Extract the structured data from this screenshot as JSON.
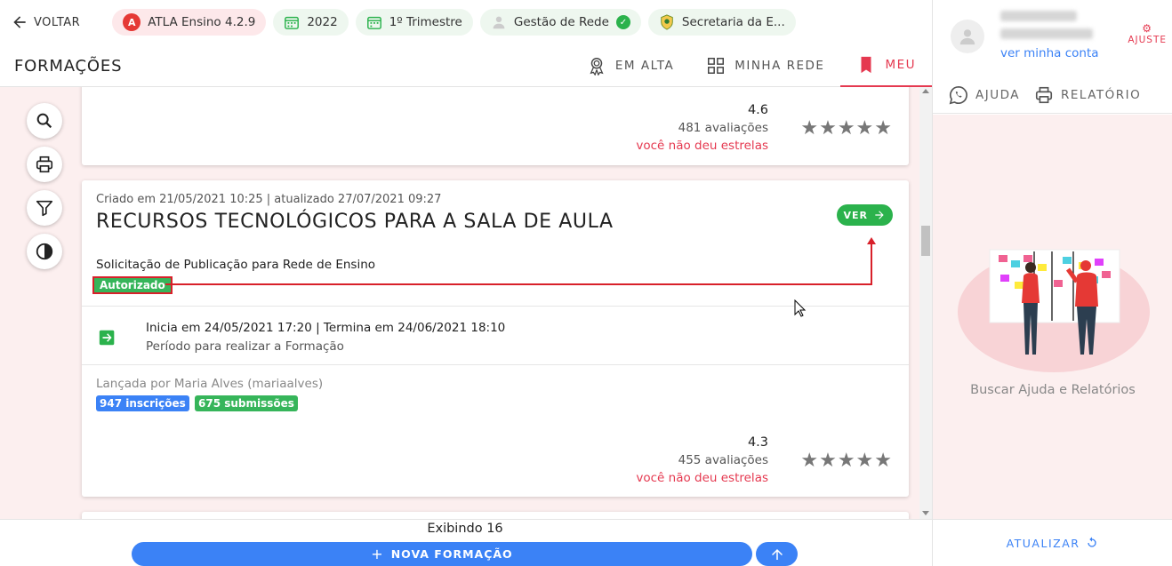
{
  "header": {
    "back_label": "VOLTAR",
    "chips": {
      "app": "ATLA Ensino 4.2.9",
      "app_logo": "A",
      "year": "2022",
      "term": "1º Trimestre",
      "role": "Gestão de Rede",
      "org": "Secretaria da E..."
    },
    "page_title": "FORMAÇÕES",
    "tabs": {
      "trending": "EM ALTA",
      "network": "MINHA REDE",
      "mine": "MEU"
    }
  },
  "cards": {
    "first": {
      "score": "4.6",
      "reviews": "481 avaliações",
      "no_rating": "você não deu estrelas",
      "stars": "★★★★★"
    },
    "second": {
      "meta": "Criado em 21/05/2021 10:25 | atualizado 27/07/2021 09:27",
      "title": "RECURSOS TECNOLÓGICOS PARA A SALA DE AULA",
      "view_label": "VER",
      "request": "Solicitação de Publicação para Rede de Ensino",
      "status": "Autorizado",
      "period": "Inicia em 24/05/2021 17:20 | Termina em 24/06/2021 18:10",
      "period_sub": "Período para realizar a Formação",
      "launched_by": "Lançada por Maria Alves (mariaalves)",
      "enrollments": "947 inscrições",
      "submissions": "675 submissões",
      "score": "4.3",
      "reviews": "455 avaliações",
      "no_rating": "você não deu estrelas",
      "stars": "★★★★★"
    }
  },
  "footer": {
    "showing": "Exibindo 16",
    "new_label": "NOVA FORMAÇÃO",
    "new_plus": "+"
  },
  "sidebar": {
    "account_link": "ver minha conta",
    "settings_label": "AJUSTE",
    "settings_glyph": "⚙",
    "help_tab": "AJUDA",
    "report_tab": "RELATÓRIO",
    "help_title": "Buscar Ajuda e Relatórios",
    "refresh_label": "ATUALIZAR"
  },
  "colors": {
    "accent_red": "#e53950",
    "primary_blue": "#3b82f6",
    "success_green": "#2bb24c",
    "content_bg": "#fcefef"
  }
}
